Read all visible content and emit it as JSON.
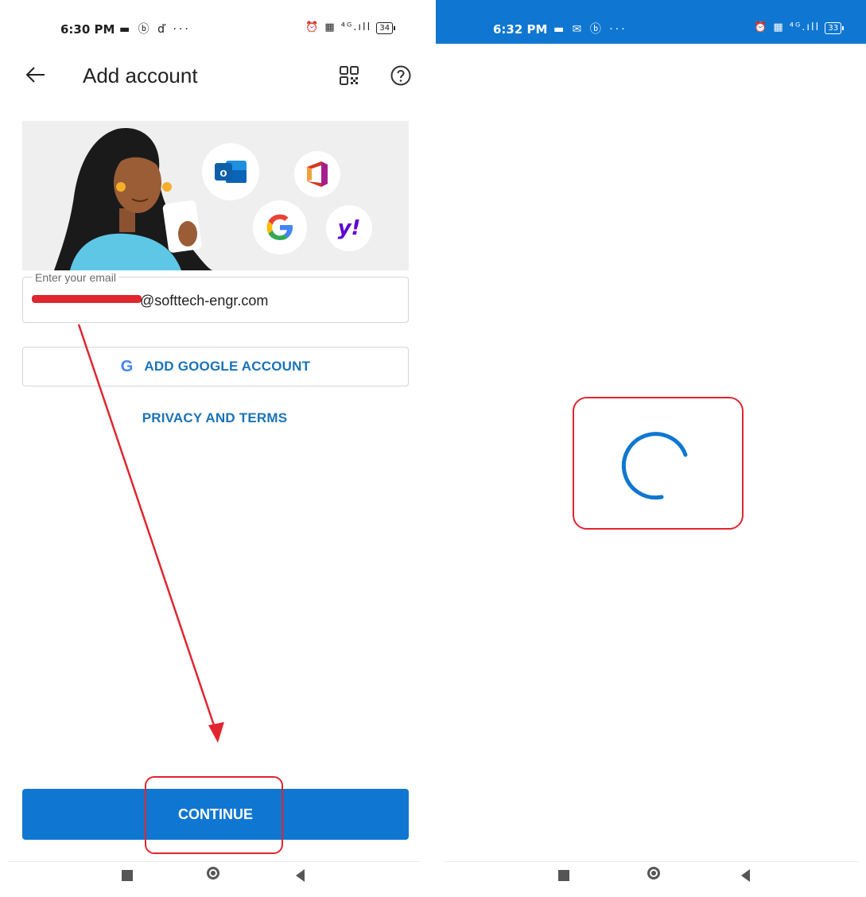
{
  "left_screen": {
    "status_bar": {
      "time": "6:30 PM",
      "left_icons": "▬ ⓑ ď ···",
      "signal": "⏰ ▦ ⁴ᴳ.ıll",
      "battery": "34"
    },
    "header": {
      "title": "Add account",
      "back_icon": "back-arrow-icon",
      "qr_icon": "qr-code-icon",
      "help_icon": "help-icon"
    },
    "hero": {
      "provider_icons": [
        "outlook-icon",
        "office-icon",
        "google-icon",
        "yahoo-icon"
      ],
      "yahoo_text": "y!",
      "outlook_letter": "o"
    },
    "email_field": {
      "label": "Enter your email",
      "value": "@softtech-engr.com"
    },
    "google_button": {
      "label": "ADD GOOGLE ACCOUNT",
      "icon_letter": "G"
    },
    "privacy_link": "PRIVACY AND TERMS",
    "continue_button": {
      "label": "CONTINUE"
    }
  },
  "right_screen": {
    "status_bar": {
      "time": "6:32 PM",
      "left_icons": "▬ ✉ ⓑ ···",
      "signal": "⏰ ▦ ⁴ᴳ.ıll",
      "battery": "33"
    },
    "loading": {
      "icon": "loading-spinner-icon"
    }
  },
  "colors": {
    "brand_blue": "#0f77d1",
    "link_blue": "#1a73b8",
    "annotation_red": "#e0262f",
    "hero_bg": "#efefef"
  }
}
